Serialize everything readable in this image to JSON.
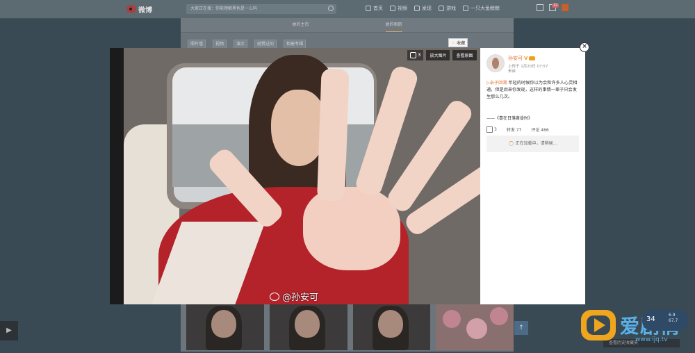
{
  "topbar": {
    "logo_text": "微博",
    "search_placeholder": "大家正在搜：你能理解黑色是一么吗",
    "nav": [
      {
        "label": "首页",
        "icon": "home-icon"
      },
      {
        "label": "视频",
        "icon": "video-icon"
      },
      {
        "label": "发现",
        "icon": "discover-icon"
      },
      {
        "label": "游戏",
        "icon": "game-icon"
      },
      {
        "label": "一只大鱼鲸鲸",
        "icon": "user-icon"
      }
    ],
    "message_badge": "32"
  },
  "profile_tabs": [
    "她的主页",
    "她的相册"
  ],
  "album_subtabs": [
    "照片墙",
    "视频",
    "演示",
    "她赞过的",
    "相册专辑"
  ],
  "viewer": {
    "like_count": "3",
    "zoom_label": "放大图片",
    "original_label": "查看原图",
    "collect_label": "收藏",
    "photo_credit": "@孙安可",
    "close_symbol": "×"
  },
  "post": {
    "author": "孙安可",
    "upload_line": "上传于 1月20日 07:57",
    "source_line": "来自",
    "tag": "▷亲子回溯",
    "text": "年轻的时候你以为会和许多人心灵相通，但是后来你发现，这样的事情一辈子只会发生那么几次。",
    "quote": "——《喜在日落黄昏时》",
    "likes": "3",
    "reposts": "转发 77",
    "comments": "评论 466",
    "loading": "正在加载中，请稍候..."
  },
  "watermark": {
    "site_name": "爱剧情",
    "url": "www.ijq.tv"
  },
  "speed_widget": {
    "percent": "34",
    "up": "6.9",
    "down": "67.7"
  },
  "bottom_strip_text": "查看历史收藏夹"
}
